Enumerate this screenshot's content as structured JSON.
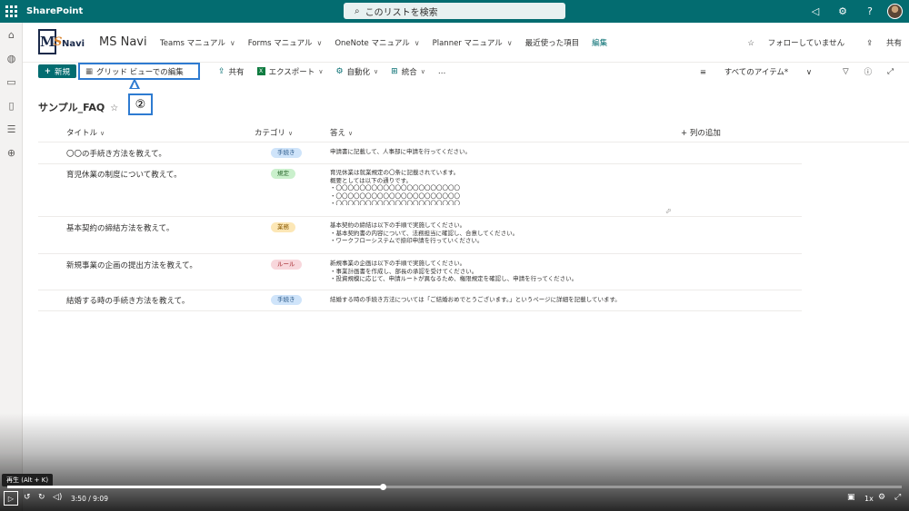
{
  "suite": {
    "brand": "SharePoint",
    "search_placeholder": "このリストを検索",
    "icons": [
      "megaphone-icon",
      "gear-icon",
      "help-icon"
    ]
  },
  "site": {
    "logo_m": "M",
    "logo_s": "S",
    "logo_navi": "Navi",
    "title": "MS Navi",
    "nav": [
      {
        "label": "Teams マニュアル"
      },
      {
        "label": "Forms マニュアル"
      },
      {
        "label": "OneNote マニュアル"
      },
      {
        "label": "Planner マニュアル"
      },
      {
        "label": "最近使った項目"
      }
    ],
    "nav_edit": "編集",
    "follow": "フォローしていません",
    "share": "共有"
  },
  "commands": {
    "new": "新規",
    "grid_edit": "グリッド ビューでの編集",
    "share": "共有",
    "export": "エクスポート",
    "automate": "自動化",
    "integrate": "統合",
    "more": "…",
    "view": "すべてのアイテム*"
  },
  "callout_label": "②",
  "list": {
    "title": "サンプル_FAQ",
    "columns": {
      "title": "タイトル",
      "category": "カテゴリ",
      "answer": "答え",
      "add": "列の追加"
    },
    "rows": [
      {
        "title": "〇〇の手続き方法を教えて。",
        "category": "手続き",
        "answer": [
          "申請書に記載して、人事部に申請を行ってください。"
        ]
      },
      {
        "title": "育児休業の制度について教えて。",
        "category": "規定",
        "answer": [
          "育児休業は就業規定の〇条に記載されています。",
          "概要としては以下の通りです。",
          "・〇〇〇〇〇〇〇〇〇〇〇〇〇〇〇〇〇〇〇〇〇",
          "・〇〇〇〇〇〇〇〇〇〇〇〇〇〇〇〇〇〇〇〇〇",
          "・〇〇〇〇〇〇〇〇〇〇〇〇〇〇〇〇〇〇〇〇〇"
        ]
      },
      {
        "title": "基本契約の締結方法を教えて。",
        "category": "業務",
        "answer": [
          "基本契約の締結は以下の手順で実施してください。",
          "・基本契約書の内容について、法務担当に確認し、合意してください。",
          "・ワークフローシステムで捺印申請を行っていください。"
        ]
      },
      {
        "title": "新規事業の企画の提出方法を教えて。",
        "category": "ルール",
        "answer": [
          "新規事業の企画は以下の手順で実施してください。",
          "・事業計画書を作成し、部長の承認を受けてください。",
          "・投資規模に応じて、申請ルートが異なるため、権限規定を確認し、申請を行ってください。"
        ]
      },
      {
        "title": "結婚する時の手続き方法を教えて。",
        "category": "手続き",
        "answer": [
          "結婚する時の手続き方法については「ご結婚おめでとうございます。」というページに詳細を記載しています。"
        ]
      }
    ]
  },
  "colors": {
    "suite": "#036c70",
    "accent": "#036c70",
    "highlight": "#2e7bd1",
    "badge_tetsuzuki": "#cfe4fa",
    "badge_kitei": "#caf0cc",
    "badge_gyomu": "#fce7b6",
    "badge_rule": "#f8d7dc"
  },
  "video": {
    "tooltip": "再生 (Alt + K)",
    "time": "3:50 / 9:09",
    "speed": "1x",
    "progress": 0.42
  }
}
